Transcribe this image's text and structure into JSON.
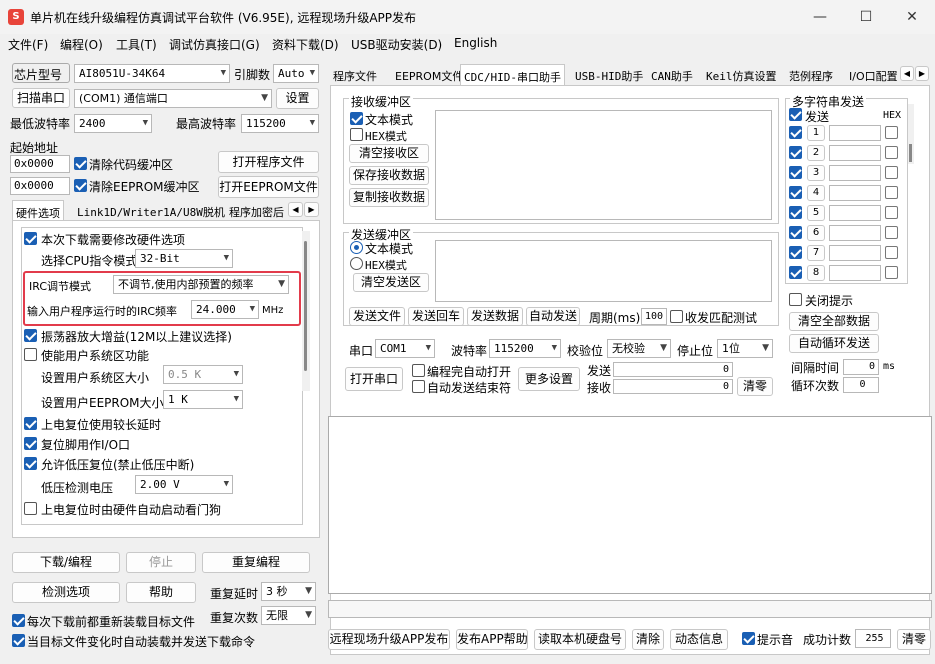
{
  "window": {
    "title": "单片机在线升级编程仿真调试平台软件 (V6.95E), 远程现场升级APP发布",
    "minimize": "—",
    "maximize": "☐",
    "close": "✕"
  },
  "menu": [
    "文件(F)",
    "编程(O)",
    "工具(T)",
    "调试仿真接口(G)",
    "资料下载(D)",
    "USB驱动安装(D)",
    "English"
  ],
  "left": {
    "chip_label": "芯片型号",
    "chip_value": "AI8051U-34K64",
    "pins_label": "引脚数",
    "pins_value": "Auto",
    "scan_button": "扫描串口",
    "port_value": "(COM1) 通信端口",
    "settings_button": "设置",
    "min_baud_label": "最低波特率",
    "min_baud_value": "2400",
    "max_baud_label": "最高波特率",
    "max_baud_value": "115200",
    "start_addr_label": "起始地址",
    "addr1": "0x0000",
    "clear_code_label": "清除代码缓冲区",
    "open_program_button": "打开程序文件",
    "addr2": "0x0000",
    "clear_eeprom_label": "清除EEPROM缓冲区",
    "open_eeprom_button": "打开EEPROM文件",
    "tabs": [
      "硬件选项",
      "Link1D/Writer1A/U8W脱机",
      "程序加密后"
    ],
    "hw": {
      "modify_label": "本次下载需要修改硬件选项",
      "cpu_mode_label": "选择CPU指令模式",
      "cpu_mode_value": "32-Bit",
      "irc_mode_label": "IRC调节模式",
      "irc_mode_value": "不调节,使用内部预置的频率",
      "irc_freq_label": "输入用户程序运行时的IRC频率",
      "irc_freq_value": "24.000",
      "irc_freq_unit": "MHz",
      "osc_gain_label": "振荡器放大增益(12M以上建议选择)",
      "user_sys_label": "使能用户系统区功能",
      "user_sys_size_label": "设置用户系统区大小",
      "user_sys_size_value": "0.5 K",
      "user_eeprom_label": "设置用户EEPROM大小",
      "user_eeprom_value": "1   K",
      "long_delay_label": "上电复位使用较长延时",
      "reset_io_label": "复位脚用作I/O口",
      "lvr_label": "允许低压复位(禁止低压中断)",
      "lvd_label": "低压检测电压",
      "lvd_value": "2.00 V",
      "wdt_label": "上电复位时由硬件自动启动看门狗"
    },
    "download_button": "下载/编程",
    "stop_button": "停止",
    "reprogram_button": "重复编程",
    "check_button": "检测选项",
    "help_button": "帮助",
    "repeat_delay_label": "重复延时",
    "repeat_delay_value": "3 秒",
    "repeat_count_label": "重复次数",
    "repeat_count_value": "无限",
    "reload_label": "每次下载前都重新装载目标文件",
    "auto_label": "当目标文件变化时自动装载并发送下载命令"
  },
  "right": {
    "tabs": [
      "程序文件",
      "EEPROM文件",
      "CDC/HID-串口助手",
      "USB-HID助手",
      "CAN助手",
      "Keil仿真设置",
      "范例程序",
      "I/O口配置"
    ],
    "rx_group": "接收缓冲区",
    "rx_text_mode": "文本模式",
    "rx_hex_mode": "HEX模式",
    "rx_clear": "清空接收区",
    "rx_save": "保存接收数据",
    "rx_copy": "复制接收数据",
    "tx_group": "发送缓冲区",
    "tx_text_mode": "文本模式",
    "tx_hex_mode": "HEX模式",
    "tx_clear": "清空发送区",
    "send_file": "发送文件",
    "send_return": "发送回车",
    "send_data": "发送数据",
    "auto_send": "自动发送",
    "period_label": "周期(ms)",
    "period_value": "100",
    "match_label": "收发匹配测试",
    "multi_group": "多字符串发送",
    "multi_send": "发送",
    "multi_hex": "HEX",
    "multi_rows": [
      "1",
      "2",
      "3",
      "4",
      "5",
      "6",
      "7",
      "8"
    ],
    "close_hint": "关闭提示",
    "clear_all": "清空全部数据",
    "auto_loop": "自动循环发送",
    "interval_label": "间隔时间",
    "interval_value": "0",
    "interval_unit": "ms",
    "loop_count_label": "循环次数",
    "loop_count_value": "0",
    "port_label": "串口",
    "port_value": "COM1",
    "baud_label": "波特率",
    "baud_value": "115200",
    "parity_label": "校验位",
    "parity_value": "无校验",
    "stop_label": "停止位",
    "stop_value": "1位",
    "open_port": "打开串口",
    "open_after_prog": "编程完自动打开",
    "close_after_auto": "自动发送结束符",
    "more_settings": "更多设置",
    "send_label": "发送",
    "send_count": "0",
    "recv_label": "接收",
    "recv_count": "0",
    "clear_count": "清零",
    "bottom_buttons": [
      "远程现场升级APP发布",
      "发布APP帮助",
      "读取本机硬盘号",
      "清除",
      "动态信息"
    ],
    "sound_label": "提示音",
    "success_label": "成功计数",
    "success_value": "255",
    "success_clear": "清零"
  }
}
